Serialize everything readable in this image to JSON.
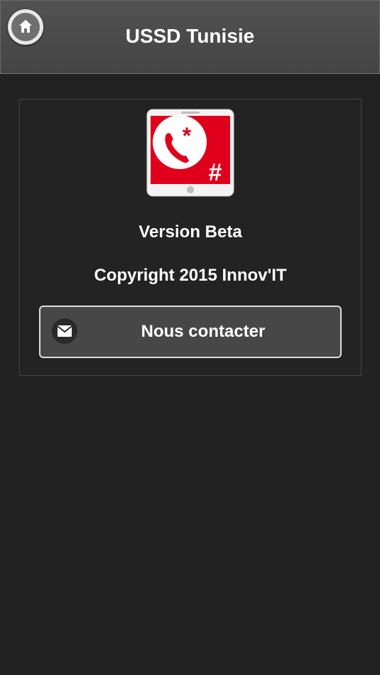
{
  "header": {
    "title": "USSD Tunisie",
    "home_icon": "home-icon"
  },
  "about": {
    "app_icon": "ussd-app-icon",
    "version": "Version Beta",
    "copyright": "Copyright 2015 Innov'IT",
    "contact_button": {
      "label": "Nous contacter",
      "icon": "mail-icon"
    }
  },
  "colors": {
    "background": "#222222",
    "header": "#4b4b4b",
    "accent_red": "#e0001b",
    "text": "#ffffff"
  }
}
